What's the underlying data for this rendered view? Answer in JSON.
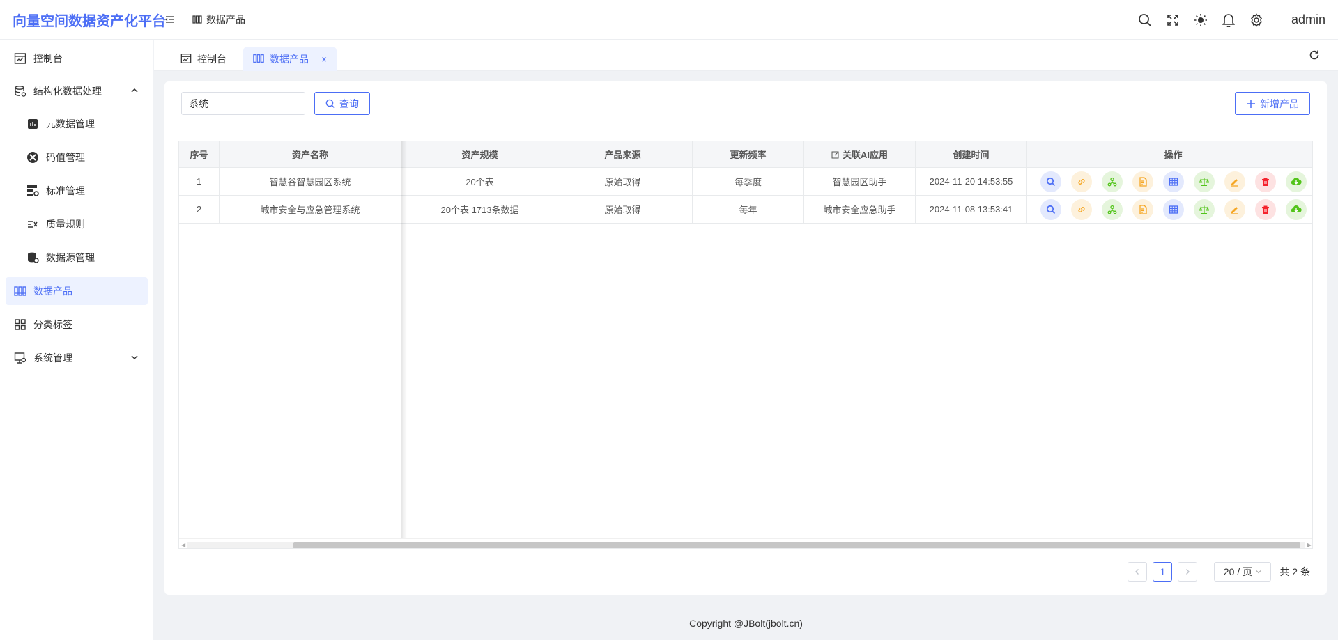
{
  "app": {
    "title": "向量空间数据资产化平台",
    "user": "admin"
  },
  "header": {
    "breadcrumb": "数据产品",
    "icons": [
      "search-icon",
      "fullscreen-icon",
      "theme-sun-icon",
      "bell-icon",
      "gear-icon"
    ]
  },
  "sidebar": {
    "items": [
      {
        "label": "控制台",
        "icon": "dashboard-icon"
      },
      {
        "label": "结构化数据处理",
        "icon": "database-process-icon",
        "expanded": true
      },
      {
        "label": "元数据管理",
        "icon": "metadata-icon"
      },
      {
        "label": "码值管理",
        "icon": "code-value-icon"
      },
      {
        "label": "标准管理",
        "icon": "standard-icon"
      },
      {
        "label": "质量规则",
        "icon": "quality-rule-icon"
      },
      {
        "label": "数据源管理",
        "icon": "datasource-icon"
      },
      {
        "label": "数据产品",
        "icon": "data-product-icon",
        "active": true
      },
      {
        "label": "分类标签",
        "icon": "category-tag-icon"
      },
      {
        "label": "系统管理",
        "icon": "system-icon",
        "expanded": false
      }
    ]
  },
  "tabs": [
    {
      "label": "控制台",
      "active": false
    },
    {
      "label": "数据产品",
      "active": true,
      "close": "×"
    }
  ],
  "toolbar": {
    "search_value": "系统",
    "query_label": "查询",
    "add_label": "新增产品"
  },
  "table": {
    "columns": {
      "index": "序号",
      "name": "资产名称",
      "scale": "资产规模",
      "source": "产品来源",
      "frequency": "更新频率",
      "ai_app": "关联AI应用",
      "created": "创建时间",
      "ops": "操作"
    },
    "rows": [
      {
        "index": "1",
        "name": "智慧谷智慧园区系统",
        "scale": "20个表",
        "source": "原始取得",
        "frequency": "每季度",
        "ai_app": "智慧园区助手",
        "created": "2024-11-20 14:53:55"
      },
      {
        "index": "2",
        "name": "城市安全与应急管理系统",
        "scale": "20个表 1713条数据",
        "source": "原始取得",
        "frequency": "每年",
        "ai_app": "城市安全应急助手",
        "created": "2024-11-08 13:53:41"
      }
    ],
    "op_icons": [
      "view-icon",
      "link-icon",
      "share-icon",
      "document-icon",
      "table-icon",
      "scale-icon",
      "edit-icon",
      "delete-icon",
      "download-icon"
    ],
    "op_colors": {
      "view": "#4c6ef5",
      "link": "#f5a623",
      "share": "#52c41a",
      "doc": "#f5a623",
      "table": "#4c6ef5",
      "scale": "#52c41a",
      "edit": "#f5a623",
      "delete": "#f5222d",
      "download": "#52c41a"
    }
  },
  "pagination": {
    "current": "1",
    "page_size": "20 / 页",
    "total": "共 2 条"
  },
  "footer": {
    "copyright": "Copyright @JBolt(jbolt.cn)"
  },
  "colors": {
    "primary": "#4c6ef5",
    "active_bg": "#edf2ff"
  }
}
